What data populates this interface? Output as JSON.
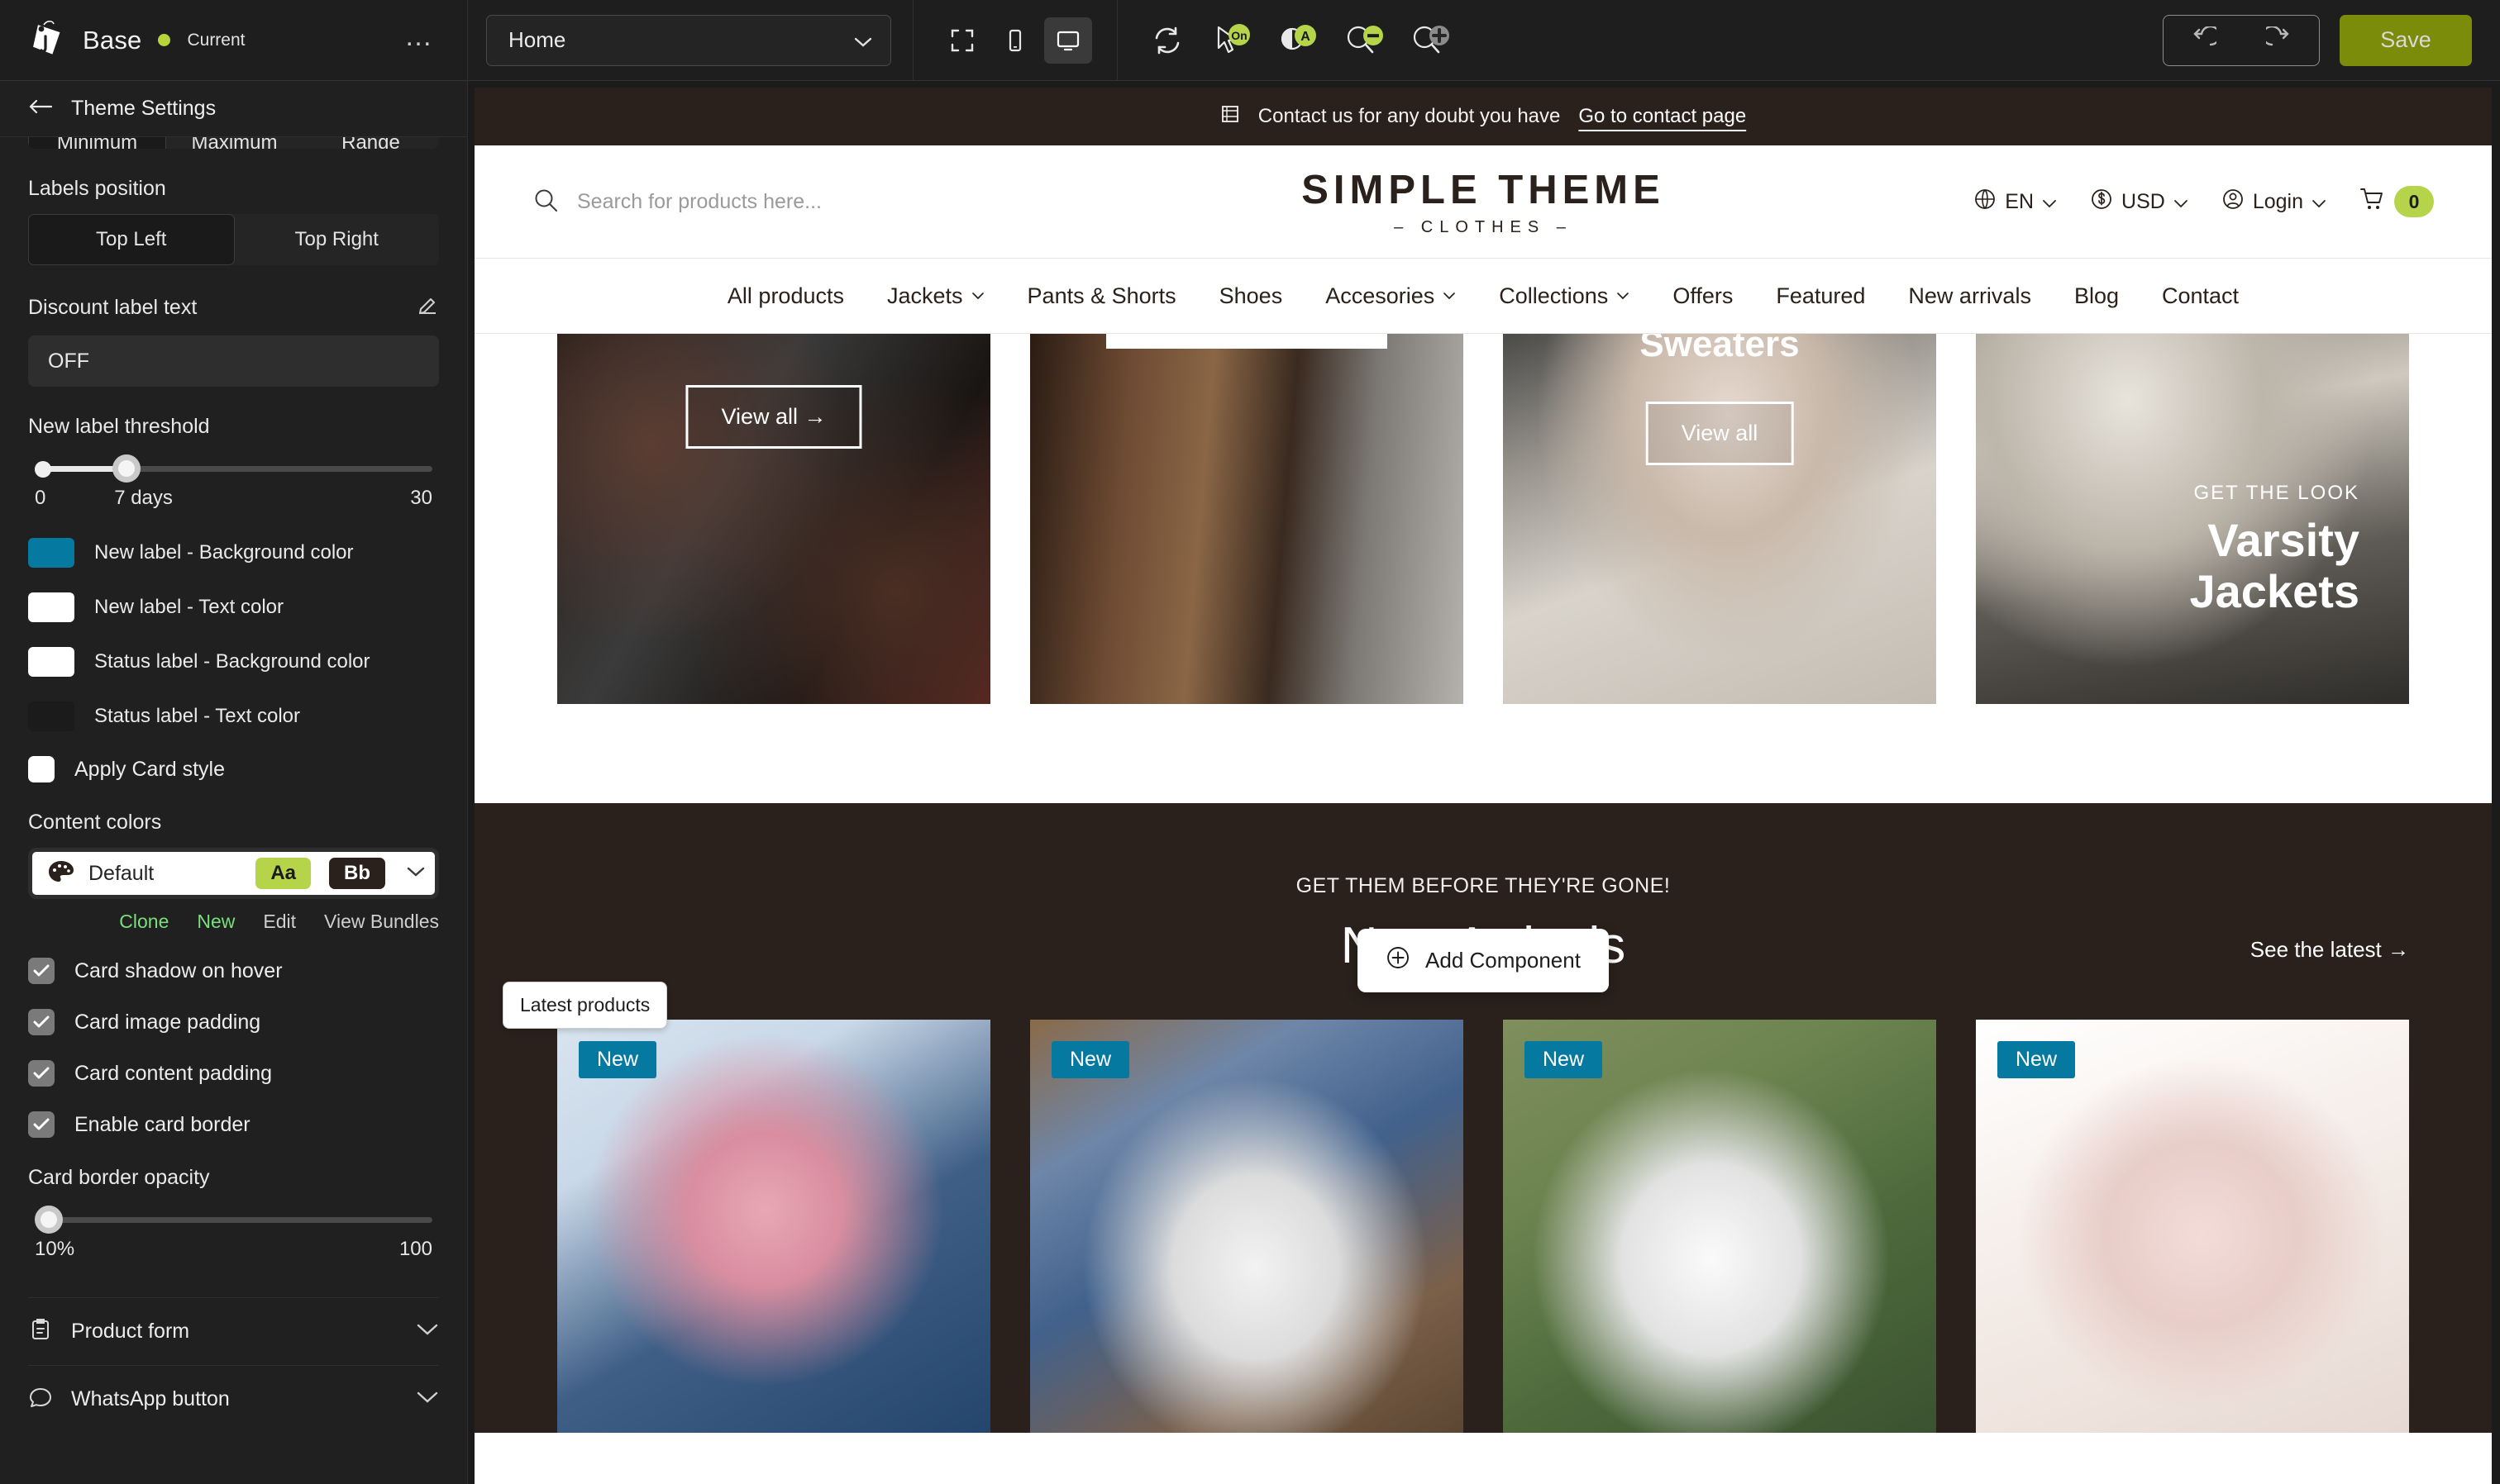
{
  "topbar": {
    "brand_name": "Base",
    "status_label": "Current",
    "more_label": "…",
    "page_select_value": "Home",
    "view_modes": [
      {
        "name": "fullscreen",
        "icon": "fullscreen-icon"
      },
      {
        "name": "mobile",
        "icon": "mobile-icon"
      },
      {
        "name": "desktop",
        "icon": "desktop-icon"
      }
    ],
    "tools": [
      {
        "name": "refresh",
        "icon": "refresh-icon",
        "badge": ""
      },
      {
        "name": "pointer-toggle",
        "icon": "cursor-icon",
        "badge": "On"
      },
      {
        "name": "contrast",
        "icon": "contrast-icon",
        "badge": "A"
      },
      {
        "name": "zoom-out",
        "icon": "zoom-out-icon",
        "badge": "-"
      },
      {
        "name": "zoom-in",
        "icon": "zoom-in-icon",
        "badge": "+"
      }
    ],
    "undo_label": "Undo",
    "redo_label": "Redo",
    "save_label": "Save"
  },
  "sidebar": {
    "title": "Theme Settings",
    "back_label": "Back",
    "cut_segment": {
      "options": [
        "Minimum",
        "Maximum",
        "Range"
      ],
      "selected": "Minimum"
    },
    "labels_position": {
      "label": "Labels position",
      "options": [
        "Top Left",
        "Top Right"
      ],
      "selected": "Top Left"
    },
    "discount_label_text": {
      "label": "Discount label text",
      "value": "OFF"
    },
    "new_label_threshold": {
      "label": "New label threshold",
      "min": "0",
      "value": "7 days",
      "max": "30",
      "percent": 23
    },
    "colors": [
      {
        "label": "New label - Background color",
        "hex": "#0579a0"
      },
      {
        "label": "New label - Text color",
        "hex": "#ffffff"
      },
      {
        "label": "Status label - Background color",
        "hex": "#ffffff"
      },
      {
        "label": "Status label - Text color",
        "hex": "#1b1b1b"
      }
    ],
    "apply_card_style": {
      "label": "Apply Card style",
      "checked": false
    },
    "content_colors": {
      "label": "Content colors",
      "selected": "Default",
      "badge_a": "Aa",
      "badge_b": "Bb",
      "actions": [
        {
          "label": "Clone",
          "style": "green"
        },
        {
          "label": "New",
          "style": "green"
        },
        {
          "label": "Edit",
          "style": "gray"
        },
        {
          "label": "View Bundles",
          "style": "gray"
        }
      ]
    },
    "checkboxes": [
      {
        "label": "Card shadow on hover",
        "checked": true
      },
      {
        "label": "Card image padding",
        "checked": true
      },
      {
        "label": "Card content padding",
        "checked": true
      },
      {
        "label": "Enable card border",
        "checked": true
      }
    ],
    "card_border_opacity": {
      "label": "Card border opacity",
      "min": "10%",
      "max": "100",
      "percent": 2
    },
    "accordions": [
      {
        "label": "Product form",
        "icon": "clipboard-icon"
      },
      {
        "label": "WhatsApp button",
        "icon": "chat-icon"
      }
    ]
  },
  "site": {
    "announcement": {
      "icon": "mail-icon",
      "text": "Contact us for any doubt you have",
      "link": "Go to contact page"
    },
    "header": {
      "search_placeholder": "Search for products here...",
      "logo_title": "SIMPLE THEME",
      "logo_sub": "– CLOTHES –",
      "utilities": [
        {
          "icon": "globe-icon",
          "label": "EN",
          "caret": true
        },
        {
          "icon": "currency-icon",
          "label": "USD",
          "caret": true
        },
        {
          "icon": "user-icon",
          "label": "Login",
          "caret": true
        }
      ],
      "cart": {
        "icon": "cart-icon",
        "count": "0"
      }
    },
    "nav": [
      {
        "label": "All products",
        "caret": false
      },
      {
        "label": "Jackets",
        "caret": true
      },
      {
        "label": "Pants & Shorts",
        "caret": false
      },
      {
        "label": "Shoes",
        "caret": false
      },
      {
        "label": "Accesories",
        "caret": true
      },
      {
        "label": "Collections",
        "caret": true
      },
      {
        "label": "Offers",
        "caret": false
      },
      {
        "label": "Featured",
        "caret": false
      },
      {
        "label": "New arrivals",
        "caret": false
      },
      {
        "label": "Blog",
        "caret": false
      },
      {
        "label": "Contact",
        "caret": false
      }
    ],
    "collections": [
      {
        "name": "jackets-collection",
        "cta": "View all →",
        "overlay_word": ""
      },
      {
        "name": "hair-collection",
        "cta": "",
        "overlay_word": ""
      },
      {
        "name": "sweaters-collection",
        "cta": "View all",
        "overlay_word": "Sweaters"
      },
      {
        "name": "varsity-collection",
        "cta": "",
        "kicker": "GET THE LOOK",
        "title_line1": "Varsity",
        "title_line2": "Jackets"
      }
    ],
    "add_component": {
      "label": "Add Component",
      "icon": "plus-circle-icon"
    },
    "section_tag": "Latest products",
    "arrivals": {
      "kicker": "GET THEM BEFORE THEY'RE GONE!",
      "title": "New Arrivals",
      "see_more": "See the latest →",
      "products": [
        {
          "badge": "New",
          "name": "pink-flat-shoes"
        },
        {
          "badge": "New",
          "name": "white-lace-sneakers"
        },
        {
          "badge": "New",
          "name": "white-mary-jane-sneakers"
        },
        {
          "badge": "New",
          "name": "pink-high-top-sneakers"
        }
      ]
    }
  },
  "theme": {
    "accent_green": "#b5d44a",
    "save_green": "#7b8c0a",
    "brand_brown": "#2a211c",
    "new_badge_blue": "#0579a0"
  }
}
